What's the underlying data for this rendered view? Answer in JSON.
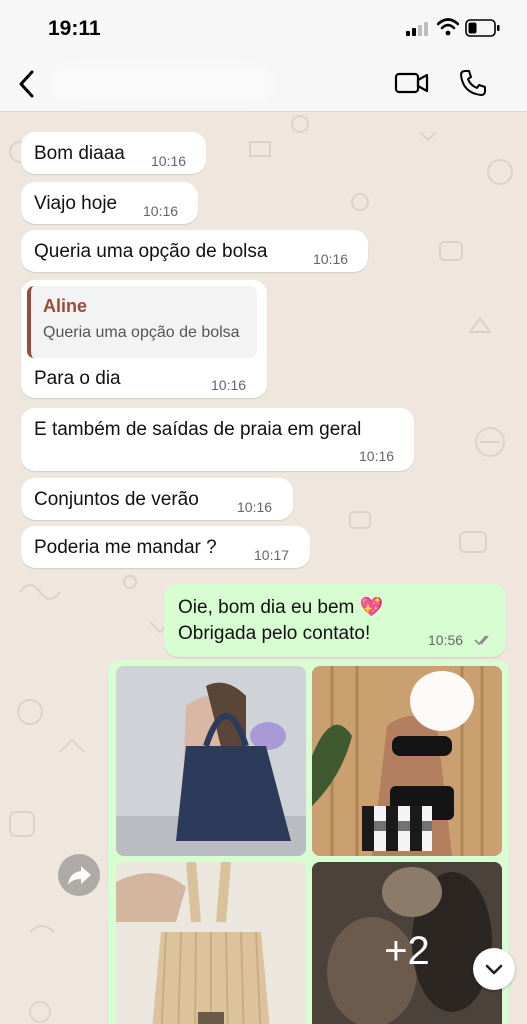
{
  "status_bar": {
    "time": "19:11",
    "signal_icon": "cellular-signal-icon",
    "wifi_icon": "wifi-icon",
    "battery_icon": "battery-icon",
    "battery_level_fraction": 0.3
  },
  "header": {
    "back_icon": "chevron-left-icon",
    "video_icon": "video-camera-icon",
    "call_icon": "phone-icon"
  },
  "messages": [
    {
      "text": "Bom diaaa",
      "time": "10:16"
    },
    {
      "text": "Viajo hoje",
      "time": "10:16"
    },
    {
      "text": "Queria uma opção de bolsa",
      "time": "10:16"
    },
    {
      "quote_author": "Aline",
      "quote_text": "Queria uma opção de bolsa",
      "text": "Para o dia",
      "time": "10:16"
    },
    {
      "text": "E também de saídas de praia em geral",
      "time": "10:16"
    },
    {
      "text": "Conjuntos de verão",
      "time": "10:16"
    },
    {
      "text": "Poderia me mandar ?",
      "time": "10:17"
    }
  ],
  "outgoing": {
    "line1": "Oie, bom dia eu bem 💖",
    "line2": "Obrigada pelo contato!",
    "time": "10:56",
    "read_icon": "double-check-icon"
  },
  "media_album": {
    "more_count": "+2",
    "forward_icon": "forward-arrow-icon",
    "scroll_icon": "chevron-down-icon"
  },
  "colors": {
    "wallpaper": "#efe7dd",
    "incoming_bubble": "#ffffff",
    "outgoing_bubble": "#d8fdd2",
    "quote_accent": "#9c4b3a",
    "read_ticks": "#8a8a8a"
  }
}
